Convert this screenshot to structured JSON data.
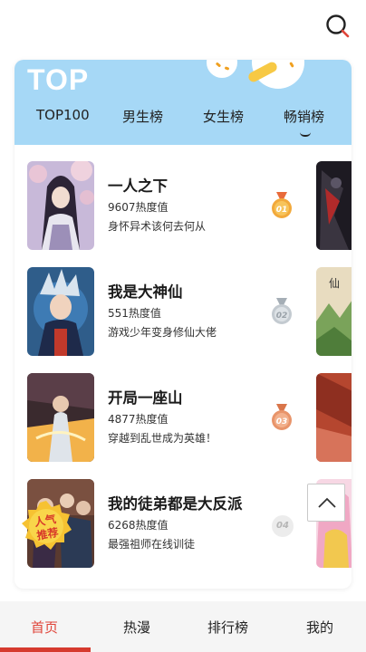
{
  "header": {
    "search_icon": "search-icon"
  },
  "ranking": {
    "title": "TOP",
    "tabs": [
      {
        "label": "TOP100"
      },
      {
        "label": "男生榜"
      },
      {
        "label": "女生榜"
      },
      {
        "label": "畅销榜",
        "selected": true
      }
    ],
    "items": [
      {
        "rank": "01",
        "title": "一人之下",
        "heat": "9607热度值",
        "desc": "身怀异术该何去何从",
        "medal": "gold"
      },
      {
        "rank": "02",
        "title": "我是大神仙",
        "heat": "551热度值",
        "desc": "游戏少年变身修仙大佬",
        "medal": "silver"
      },
      {
        "rank": "03",
        "title": "开局一座山",
        "heat": "4877热度值",
        "desc": "穿越到乱世成为英雄！",
        "medal": "bronze"
      },
      {
        "rank": "04",
        "title": "我的徒弟都是大反派",
        "heat": "6268热度值",
        "desc": "最强祖师在线训徒",
        "medal": "none"
      }
    ],
    "badge": {
      "line1": "人气",
      "line2": "推荐"
    }
  },
  "colors": {
    "header_bg": "#a6d8f6",
    "accent": "#e0453a",
    "gold": "#f2a93b",
    "silver": "#bfc6cc",
    "bronze": "#e8946a"
  },
  "bottom_nav": {
    "items": [
      {
        "label": "首页",
        "active": true
      },
      {
        "label": "热漫"
      },
      {
        "label": "排行榜"
      },
      {
        "label": "我的"
      }
    ]
  }
}
